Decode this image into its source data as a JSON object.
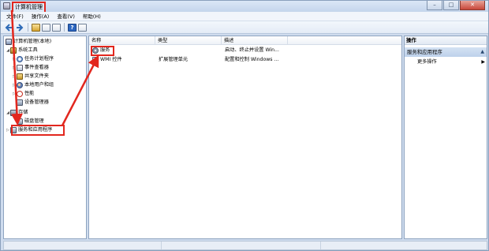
{
  "window": {
    "title": "计算机管理",
    "controls": {
      "minimize": "–",
      "maximize": "□",
      "close": "✕"
    }
  },
  "menubar": {
    "items": [
      "文件(F)",
      "操作(A)",
      "查看(V)",
      "帮助(H)"
    ]
  },
  "toolbar": {
    "buttons": [
      "back-icon",
      "forward-icon",
      "up-folder-icon",
      "show-hide-tree-icon",
      "properties-icon",
      "help-icon",
      "console-icon"
    ],
    "help_glyph": "?"
  },
  "tree": {
    "root": "计算机管理(本地)",
    "system_tools": "系统工具",
    "task_scheduler": "任务计划程序",
    "event_viewer": "事件查看器",
    "shared_folders": "共享文件夹",
    "local_users": "本地用户和组",
    "performance": "性能",
    "device_manager": "设备管理器",
    "storage": "存储",
    "disk_management": "磁盘管理",
    "services_apps": "服务和应用程序"
  },
  "list": {
    "columns": [
      "名称",
      "类型",
      "描述"
    ],
    "rows": [
      {
        "name": "服务",
        "type": "",
        "desc": "启动、终止并设置 Win..."
      },
      {
        "name": "WMI 控件",
        "type": "扩展管理单元",
        "desc": "配置和控制 Windows ..."
      }
    ]
  },
  "actions": {
    "header": "操作",
    "section": "服务和应用程序",
    "more": "更多操作"
  },
  "colors": {
    "highlight_red": "#e2271e",
    "selection_blue": "#cde2f8",
    "window_frame": "#cfdcee"
  }
}
